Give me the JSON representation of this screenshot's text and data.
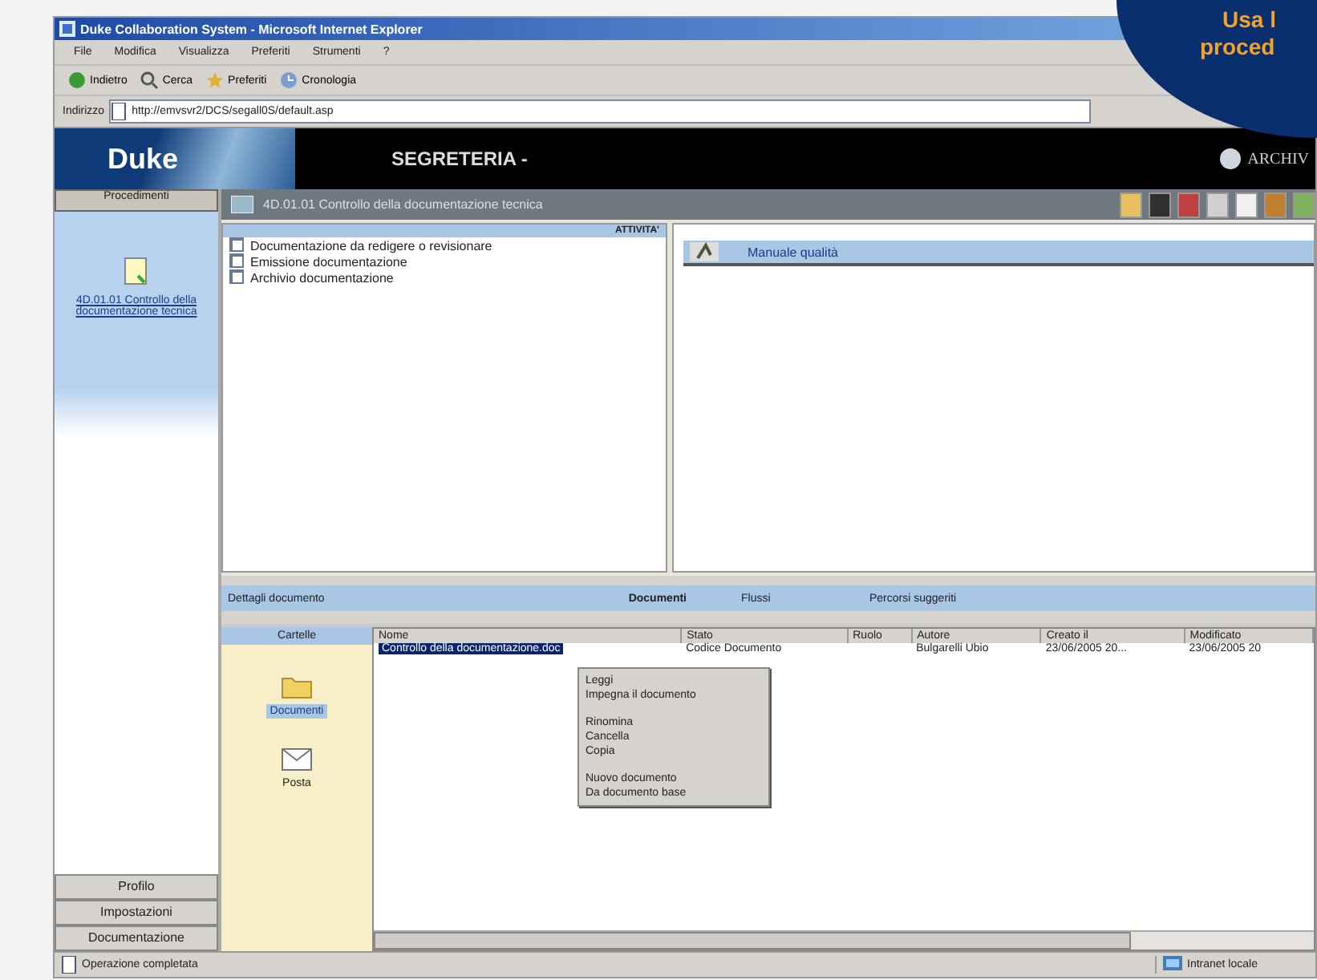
{
  "window": {
    "title": "Duke Collaboration System - Microsoft Internet Explorer"
  },
  "menu": [
    "File",
    "Modifica",
    "Visualizza",
    "Preferiti",
    "Strumenti",
    "?"
  ],
  "toolbar": [
    {
      "kind": "back",
      "label": "Indietro"
    },
    {
      "kind": "search",
      "label": "Cerca"
    },
    {
      "kind": "favorites",
      "label": "Preferiti"
    },
    {
      "kind": "history",
      "label": "Cronologia"
    }
  ],
  "address": {
    "label": "Indirizzo",
    "value": "http://emvsvr2/DCS/segall0S/default.asp"
  },
  "callout": {
    "lines": [
      "Usa l",
      "proced"
    ]
  },
  "banner": {
    "logo": "Duke",
    "section": "SEGRETERIA -",
    "right": "ARCHIV"
  },
  "sidebar": {
    "header": {
      "label": "Procedimenti",
      "selected": true
    },
    "item": "4D.01.01 Controllo della documentazione tecnica",
    "bottom_tabs": [
      {
        "label": "Profilo",
        "selected": false
      },
      {
        "label": "Impostazioni",
        "selected": false
      },
      {
        "label": "Documentazione",
        "selected": false
      }
    ]
  },
  "header": {
    "title": "4D.01.01 Controllo della documentazione tecnica"
  },
  "activities": {
    "label": "ATTIVITA'",
    "items": [
      "Documentazione da redigere o revisionare",
      "Emissione documentazione",
      "Archivio documentazione"
    ]
  },
  "manual": {
    "label": "Manuale qualità"
  },
  "tabs": [
    {
      "label": "Dettagli documento",
      "selected": false
    },
    {
      "label": "Documenti",
      "selected": true
    },
    {
      "label": "Flussi",
      "selected": false
    },
    {
      "label": "Percorsi suggeriti",
      "selected": false
    }
  ],
  "folders": {
    "header": "Cartelle",
    "items": [
      {
        "kind": "folder",
        "label": "Documenti",
        "selected": true
      },
      {
        "kind": "mail",
        "label": "Posta",
        "selected": false
      }
    ]
  },
  "table": {
    "columns": [
      "Nome",
      "Stato",
      "Ruolo",
      "Autore",
      "Creato il",
      "Modificato"
    ],
    "rows": [
      {
        "selected": true,
        "cells": [
          "Controllo della documentazione.doc",
          "Codice Documento",
          "",
          "Bulgarelli Ubio",
          "23/06/2005 20...",
          "23/06/2005 20"
        ]
      }
    ]
  },
  "context_menu": [
    [
      "Leggi",
      "Impegna il documento"
    ],
    [
      "Rinomina",
      "Cancella",
      "Copia"
    ],
    [
      "Nuovo documento",
      "Da documento base"
    ]
  ],
  "status_bar": {
    "text": "Operazione completata",
    "zone": "Intranet locale"
  }
}
